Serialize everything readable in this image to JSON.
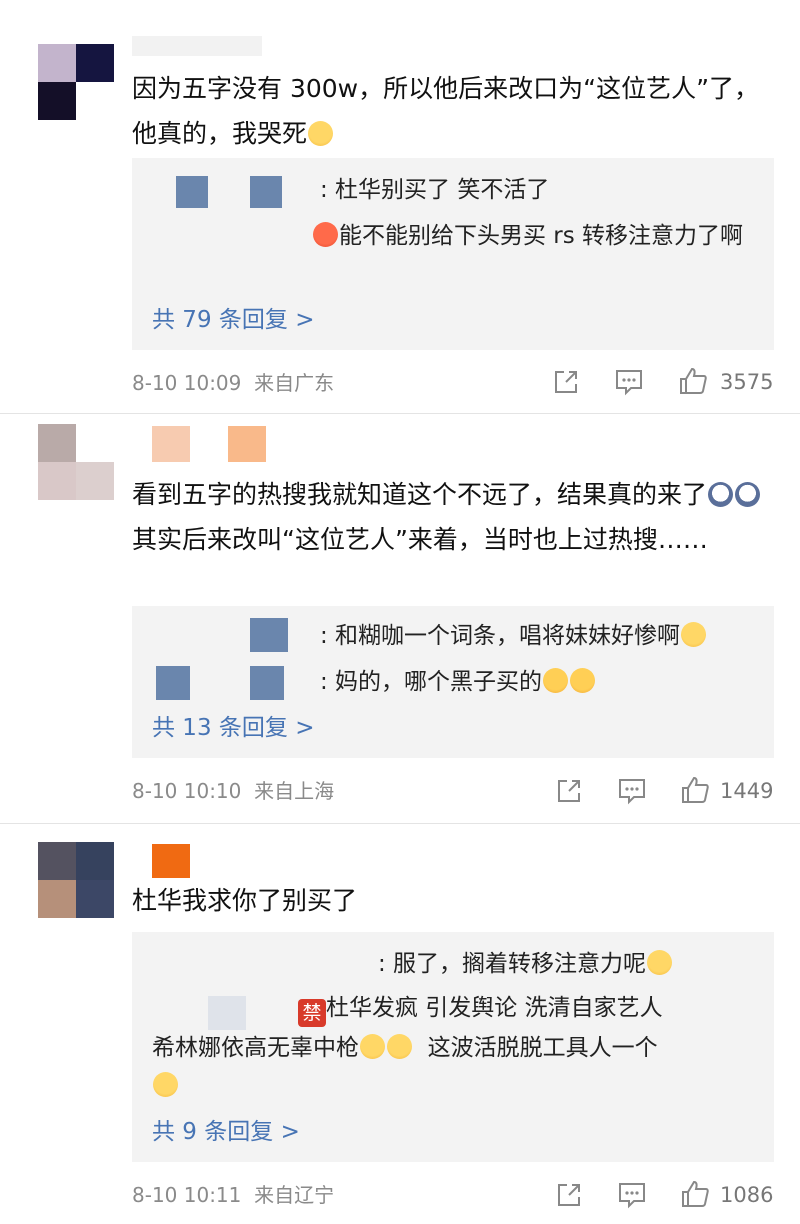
{
  "comments": [
    {
      "text": "因为五字没有 300w，所以他后来改口为“这位艺人”了，他真的，我哭死",
      "emoji_after": "crying-emoji",
      "replies": [
        {
          "text": ": 杜华别买了 笑不活了"
        },
        {
          "text": "能不能别给下头男买 rs 转移注意力了啊",
          "emoji_before": "angry-emoji"
        }
      ],
      "more_replies": "共 79 条回复 >",
      "time": "8-10 10:09",
      "location": "来自广东",
      "likes": "3575"
    },
    {
      "text_part1": "看到五字的热搜我就知道这个不远了，结果真的来了",
      "text_part2": "其实后来改叫“这位艺人”来着，当时也上过热搜……",
      "replies": [
        {
          "text": ": 和糊咖一个词条，唱将妹妹好惨啊"
        },
        {
          "text": ": 妈的，哪个黑子买的"
        }
      ],
      "more_replies": "共 13 条回复 >",
      "time": "8-10 10:10",
      "location": "来自上海",
      "likes": "1449"
    },
    {
      "text": "杜华我求你了别买了",
      "replies": [
        {
          "text": ": 服了，搁着转移注意力呢"
        },
        {
          "text_part1": "杜华发疯  引发舆论  洗清自家艺人",
          "text_part2": "希林娜依高无辜中枪",
          "text_part3": "这波活脱脱工具人一个",
          "ban_label": "禁"
        }
      ],
      "more_replies": "共 9 条回复 >",
      "time": "8-10 10:11",
      "location": "来自辽宁",
      "likes": "1086"
    }
  ],
  "colors": {
    "link": "#4774b4",
    "reply_bg": "#f3f3f3",
    "meta": "#8a8a8a"
  }
}
